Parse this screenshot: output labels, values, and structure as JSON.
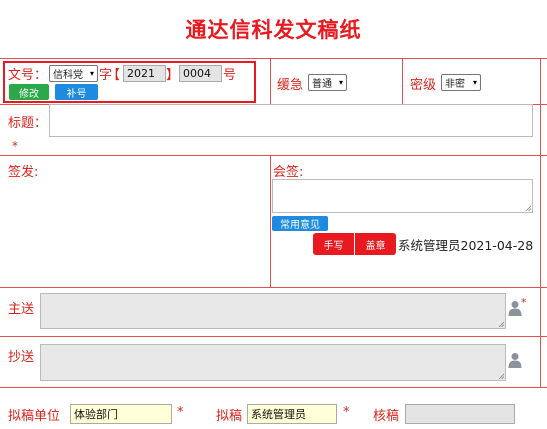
{
  "title": "通达信科发文稿纸",
  "row1": {
    "doc_no_label": "文号：",
    "doc_type_value": "信科党",
    "zi_label": "字",
    "bracket_left": "【",
    "year_value": "2021",
    "bracket_right": "】",
    "number_value": "0004",
    "hao_label": "号",
    "modify_button": "修改",
    "supplement_button": "补号",
    "urgency_label": "缓急",
    "urgency_value": "普通",
    "secrecy_label": "密级",
    "secrecy_value": "非密"
  },
  "subject": {
    "label": "标题：",
    "value": "",
    "required_mark": "*"
  },
  "sign": {
    "label": "签发:"
  },
  "countersign": {
    "label": "会签:",
    "common_opinion_button": "常用意见",
    "handwrite_button": "手写",
    "stamp_button": "盖章",
    "signer_text": "系统管理员2021-04-28"
  },
  "main_send": {
    "label": "主送",
    "required_mark": "*"
  },
  "cc": {
    "label": "抄送"
  },
  "bottom": {
    "drafting_unit_label": "拟稿单位",
    "drafting_unit_value": "体验部门",
    "drafting_unit_required": "*",
    "drafter_label": "拟稿",
    "drafter_value": "系统管理员",
    "drafter_required": "*",
    "reviewer_label": "核稿",
    "reviewer_value": ""
  },
  "icons": {
    "user_picker": "user-icon",
    "dropdown": "chevron-down-icon",
    "resize": "resize-grip-icon"
  },
  "colors": {
    "label_red": "#d9261c",
    "button_green": "#2aa84a",
    "button_blue": "#1e8be0",
    "button_red": "#e8191f",
    "field_grey": "#e8e8e8",
    "field_yellow": "#ffffd8"
  }
}
